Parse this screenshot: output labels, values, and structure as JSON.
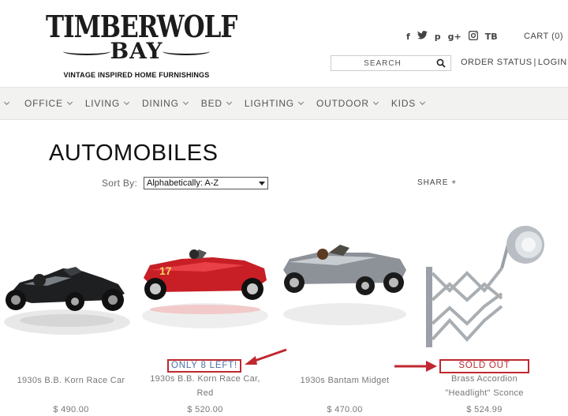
{
  "header": {
    "logo_main": "TIMBERWOLF",
    "logo_sub": "BAY",
    "logo_tagline": "VINTAGE INSPIRED HOME FURNISHINGS",
    "social_icons": [
      "facebook-icon",
      "twitter-icon",
      "pinterest-icon",
      "google-plus-icon",
      "instagram-icon",
      "tb-icon"
    ],
    "social_glyphs": [
      "f",
      "t",
      "p",
      "g+",
      "▣",
      "TB"
    ],
    "cart_label": "CART (0)",
    "search_placeholder": "SEARCH",
    "order_status_label": "ORDER STATUS",
    "account_separator": "|",
    "login_label": "LOGIN"
  },
  "nav": {
    "items": [
      {
        "label": "OFFICE"
      },
      {
        "label": "LIVING"
      },
      {
        "label": "DINING"
      },
      {
        "label": "BED"
      },
      {
        "label": "LIGHTING"
      },
      {
        "label": "OUTDOOR"
      },
      {
        "label": "KIDS"
      }
    ]
  },
  "page": {
    "title": "AUTOMOBILES",
    "sort_label": "Sort By:",
    "sort_value": "Alphabetically: A-Z",
    "share_label": "SHARE +"
  },
  "products": [
    {
      "name": "1930s B.B. Korn Race Car",
      "price": "$ 490.00",
      "image": "black-race-car"
    },
    {
      "name": "1930s B.B. Korn Race Car, Red",
      "name_line1": "1930s B.B. Korn Race Car,",
      "name_line2": "Red",
      "price": "$ 520.00",
      "image": "red-race-car",
      "badge": "ONLY 8 LEFT!",
      "badge_color": "#4a6fa5"
    },
    {
      "name": "1930s Bantam Midget",
      "price": "$ 470.00",
      "image": "silver-midget-car"
    },
    {
      "name": "Brass Accordion \"Headlight\" Sconce",
      "name_line1": "Brass Accordion",
      "name_line2": "\"Headlight\" Sconce",
      "price": "$ 524.99",
      "image": "accordion-sconce",
      "badge": "SOLD OUT",
      "badge_color": "#c0282f"
    }
  ],
  "colors": {
    "annotation_red": "#c0282f",
    "nav_background": "#f2f2f0"
  }
}
